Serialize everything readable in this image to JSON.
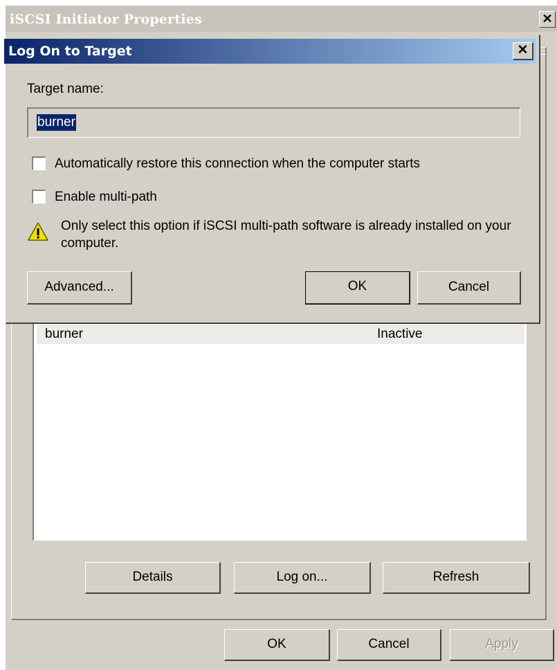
{
  "main_window": {
    "title": "iSCSI Initiator Properties",
    "close_glyph": "✕",
    "targets_list": {
      "rows": [
        {
          "name": "burner",
          "status": "Inactive"
        }
      ]
    },
    "buttons": {
      "details": "Details",
      "log_on": "Log on...",
      "refresh": "Refresh"
    },
    "footer_buttons": {
      "ok": "OK",
      "cancel": "Cancel",
      "apply": "Apply"
    }
  },
  "dialog": {
    "title": "Log On to Target",
    "close_glyph": "✕",
    "target_name_label": "Target name:",
    "target_name_value": "burner",
    "auto_restore_label": "Automatically restore this connection when the computer starts",
    "auto_restore_checked": false,
    "multipath_label": "Enable multi-path",
    "multipath_checked": false,
    "warning_text": "Only select this option if iSCSI multi-path software is already installed on your computer.",
    "buttons": {
      "advanced": "Advanced...",
      "ok": "OK",
      "cancel": "Cancel"
    }
  },
  "colors": {
    "dialog_title_start": "#0a246a",
    "dialog_title_end": "#a6caf0",
    "face": "#d4d0c8",
    "warning_yellow": "#f7e000"
  }
}
